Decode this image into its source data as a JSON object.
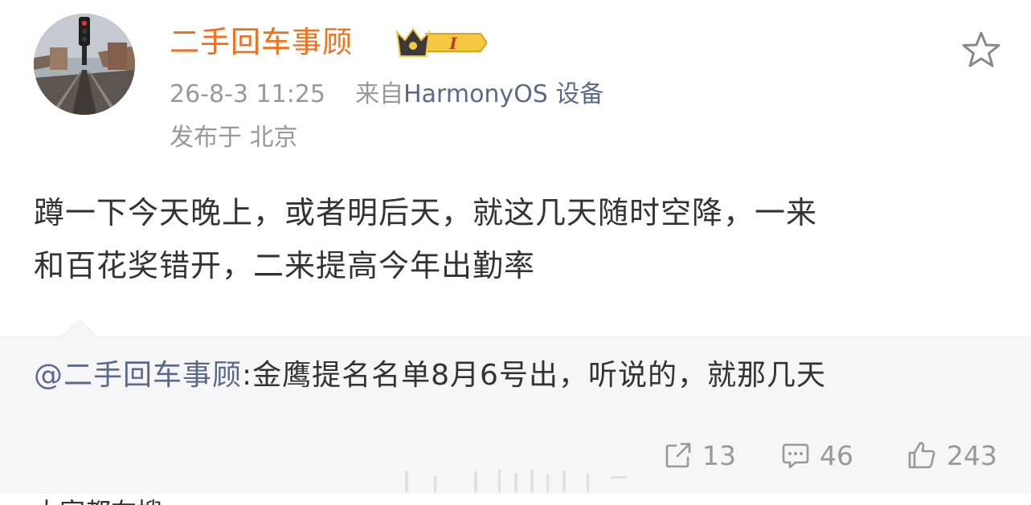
{
  "post": {
    "username": "二手回车事顾",
    "badge_text": "I",
    "time": "26-8-3 11:25",
    "source_prefix": "来自",
    "device": "HarmonyOS 设备",
    "location": "发布于 北京",
    "content_line1": "蹲一下今天晚上，或者明后天，就这几天随时空降，一来",
    "content_line2": "和百花奖错开，二来提高今年出勤率"
  },
  "repost": {
    "mention": "@二手回车事顾",
    "text": ":金鹰提名名单8月6号出，听说的，就那几天"
  },
  "actions": {
    "share_count": "13",
    "comment_count": "46",
    "like_count": "243"
  },
  "footer": {
    "cut_text": "大家都在搜"
  },
  "colors": {
    "username": "#f46f18",
    "link": "#5b6a8c",
    "meta": "#999999",
    "text": "#333333",
    "repost_bg": "#f6f6f6",
    "badge_gold": "#f5c842"
  },
  "icons": [
    "avatar-image",
    "vip-crown-badge",
    "star-icon",
    "share-icon",
    "comment-icon",
    "like-icon"
  ]
}
